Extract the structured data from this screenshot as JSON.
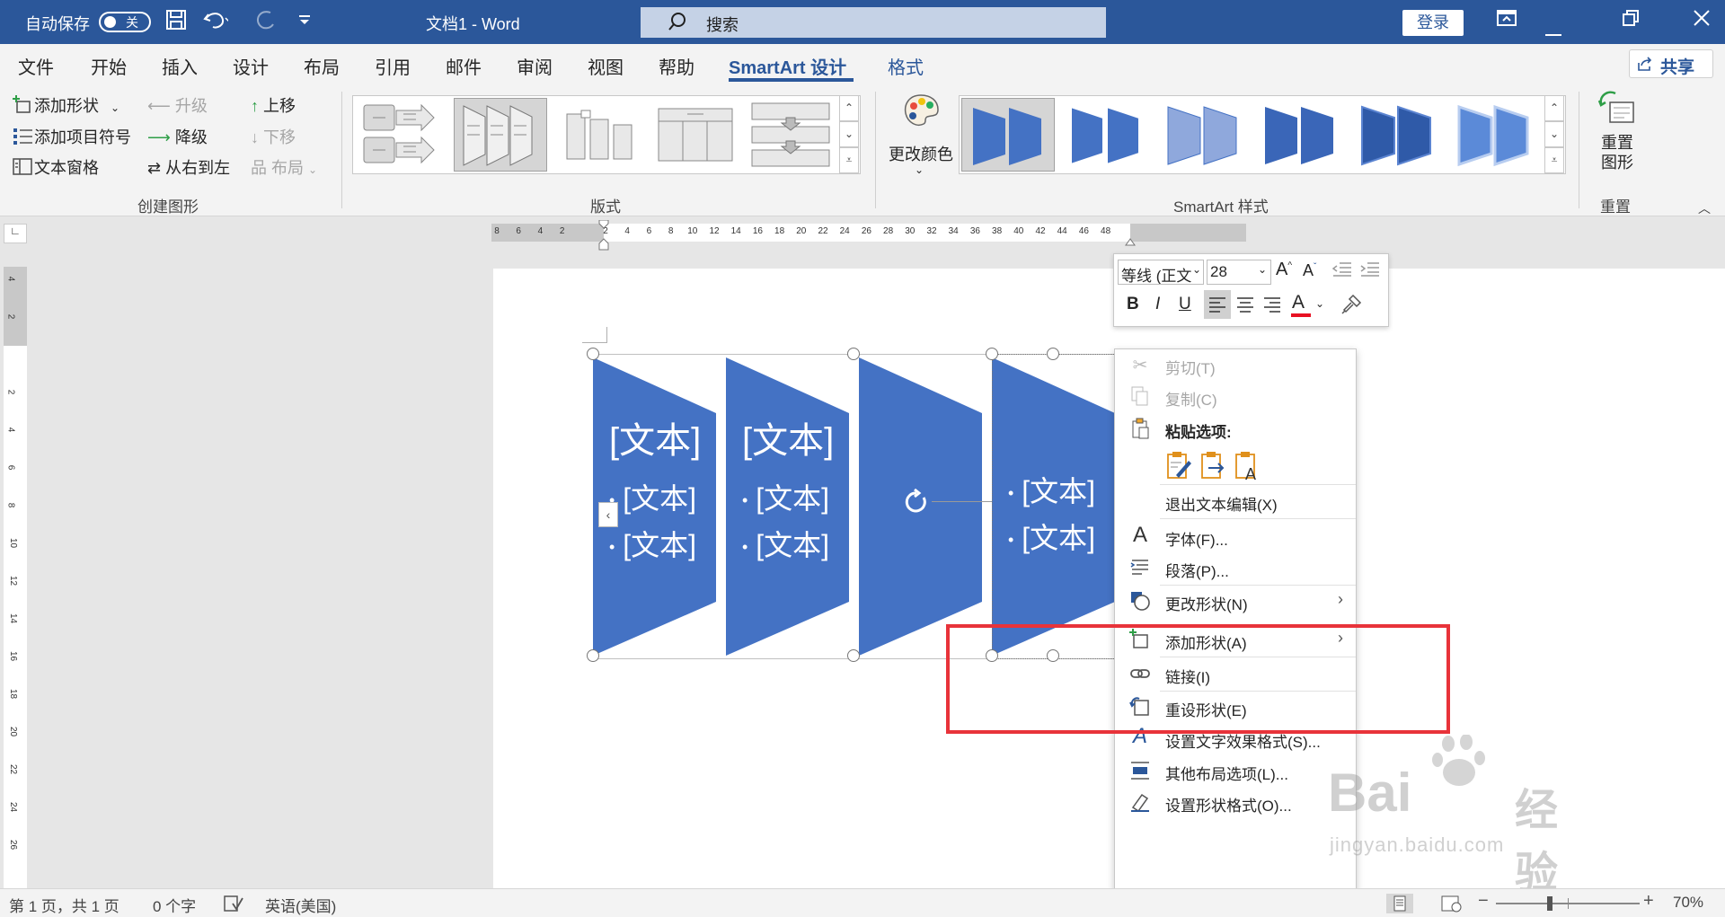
{
  "titlebar": {
    "autosave_label": "自动保存",
    "autosave_state": "关",
    "doc_title": "文档1  -  Word",
    "search_placeholder": "搜索",
    "login_label": "登录"
  },
  "menu": {
    "tabs": [
      "文件",
      "开始",
      "插入",
      "设计",
      "布局",
      "引用",
      "邮件",
      "审阅",
      "视图",
      "帮助",
      "SmartArt 设计",
      "格式"
    ],
    "active_tab": "SmartArt 设计",
    "share_label": "共享"
  },
  "ribbon": {
    "create_graphic": {
      "add_shape": "添加形状",
      "add_bullet": "添加项目符号",
      "text_pane": "文本窗格",
      "promote": "升级",
      "demote": "降级",
      "right_to_left": "从右到左",
      "move_up": "上移",
      "move_down": "下移",
      "layout": "布局",
      "group_label": "创建图形"
    },
    "layouts_group_label": "版式",
    "change_colors_label": "更改颜色",
    "styles_group_label": "SmartArt 样式",
    "reset_graphic_label": "重置图形",
    "reset_group_label": "重置"
  },
  "ruler": {
    "h_ticks": [
      "8",
      "6",
      "4",
      "2",
      "",
      "2",
      "4",
      "6",
      "8",
      "10",
      "12",
      "14",
      "16",
      "18",
      "20",
      "22",
      "24",
      "26",
      "28",
      "30",
      "32",
      "34",
      "36",
      "38",
      "40",
      "42",
      "44",
      "46",
      "48"
    ],
    "v_ticks": [
      "4",
      "2",
      "",
      "2",
      "4",
      "6",
      "8",
      "10",
      "12",
      "14",
      "16",
      "18",
      "20",
      "22",
      "24",
      "26"
    ]
  },
  "smartart": {
    "shape_main_text": "[文本]",
    "bullet_text": "[文本]",
    "shape_fill": "#4472c4"
  },
  "mini_toolbar": {
    "font_name": "等线 (正文",
    "font_size": "28",
    "bold": "B",
    "italic": "I",
    "underline": "U",
    "font_color": "#e81123"
  },
  "context_menu": {
    "cut": "剪切(T)",
    "copy": "复制(C)",
    "paste_options": "粘贴选项:",
    "exit_text_edit": "退出文本编辑(X)",
    "font": "字体(F)...",
    "paragraph": "段落(P)...",
    "change_shape": "更改形状(N)",
    "add_shape": "添加形状(A)",
    "link": "链接(I)",
    "reset_shape": "重设形状(E)",
    "text_effects": "设置文字效果格式(S)...",
    "more_layout": "其他布局选项(L)...",
    "format_shape": "设置形状格式(O)..."
  },
  "status": {
    "page": "第 1 页，共 1 页",
    "words": "0 个字",
    "language": "英语(美国)",
    "zoom": "70%"
  },
  "watermark": {
    "brand": "Bai",
    "brand2": "经验",
    "url": "jingyan.baidu.com"
  },
  "colors": {
    "title_bar": "#2b579a",
    "highlight_box": "#e8333a"
  }
}
